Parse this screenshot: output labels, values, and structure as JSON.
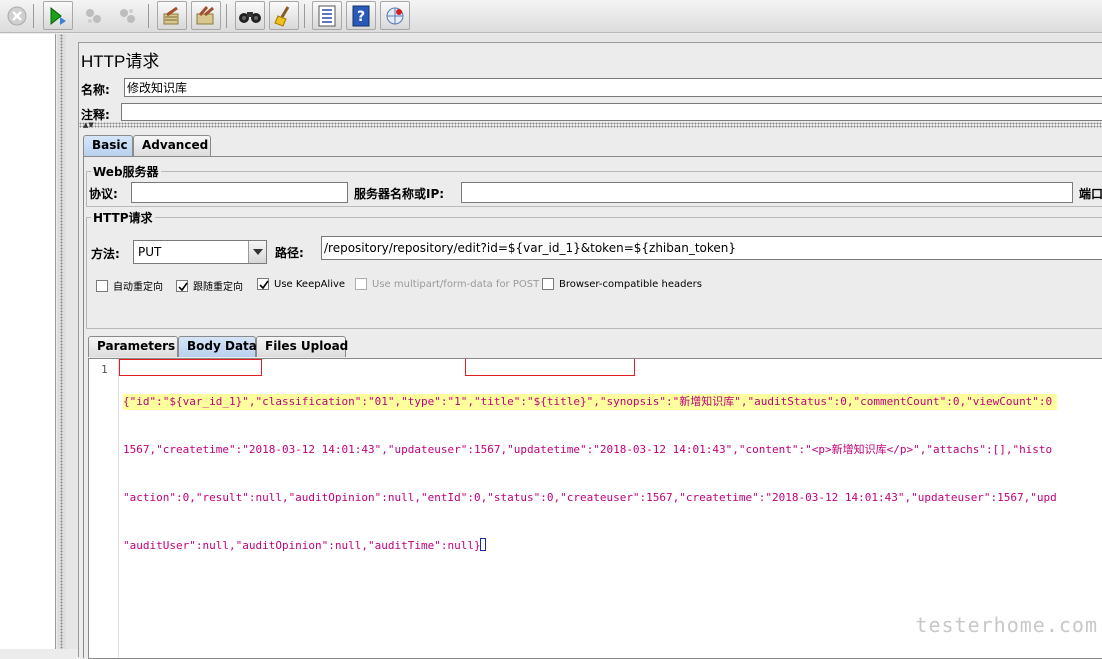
{
  "toolbar": {
    "buttons": [
      {
        "name": "stop-all-icon"
      },
      {
        "name": "start-no-pauses-icon"
      },
      {
        "name": "remote-start-icon"
      },
      {
        "name": "remote-stop-icon"
      },
      {
        "name": "clear-icon"
      },
      {
        "name": "clear-all-icon"
      },
      {
        "name": "search-binoculars-icon"
      },
      {
        "name": "reset-search-broom-icon"
      },
      {
        "name": "function-helper-icon"
      },
      {
        "name": "help-icon"
      },
      {
        "name": "remote-engines-icon"
      }
    ]
  },
  "sampler": {
    "title": "HTTP请求",
    "name_label": "名称:",
    "name_value": "修改知识库",
    "comment_label": "注释:",
    "comment_value": ""
  },
  "tabs": [
    {
      "label": "Basic",
      "active": true
    },
    {
      "label": "Advanced",
      "active": false
    }
  ],
  "web_server": {
    "legend": "Web服务器",
    "protocol_label": "协议:",
    "protocol_value": "",
    "server_label": "服务器名称或IP:",
    "server_value": "",
    "port_label": "端口"
  },
  "http_request": {
    "legend": "HTTP请求",
    "method_label": "方法:",
    "method_value": "PUT",
    "path_label": "路径:",
    "path_value": "/repository/repository/edit?id=${var_id_1}&token=${zhiban_token}"
  },
  "options": [
    {
      "label": "自动重定向",
      "checked": false,
      "disabled": false
    },
    {
      "label": "跟随重定向",
      "checked": true,
      "disabled": false
    },
    {
      "label": "Use KeepAlive",
      "checked": true,
      "disabled": false
    },
    {
      "label": "Use multipart/form-data for POST",
      "checked": false,
      "disabled": true
    },
    {
      "label": "Browser-compatible headers",
      "checked": false,
      "disabled": false
    }
  ],
  "inner_tabs": [
    {
      "label": "Parameters",
      "active": false
    },
    {
      "label": "Body Data",
      "active": true
    },
    {
      "label": "Files Upload",
      "active": false
    }
  ],
  "editor": {
    "line_number": "1",
    "lines": [
      "{\"id\":\"${var_id_1}\",\"classification\":\"01\",\"type\":\"1\",\"title\":\"${title}\",\"synopsis\":\"新增知识库\",\"auditStatus\":0,\"commentCount\":0,\"viewCount\":0",
      "1567,\"createtime\":\"2018-03-12 14:01:43\",\"updateuser\":1567,\"updatetime\":\"2018-03-12 14:01:43\",\"content\":\"<p>新增知识库</p>\",\"attachs\":[],\"histo",
      "\"action\":0,\"result\":null,\"auditOpinion\":null,\"entId\":0,\"status\":0,\"createuser\":1567,\"createtime\":\"2018-03-12 14:01:43\",\"updateuser\":1567,\"upd",
      "\"auditUser\":null,\"auditOpinion\":null,\"auditTime\":null}"
    ]
  },
  "watermark": "testerhome.com"
}
